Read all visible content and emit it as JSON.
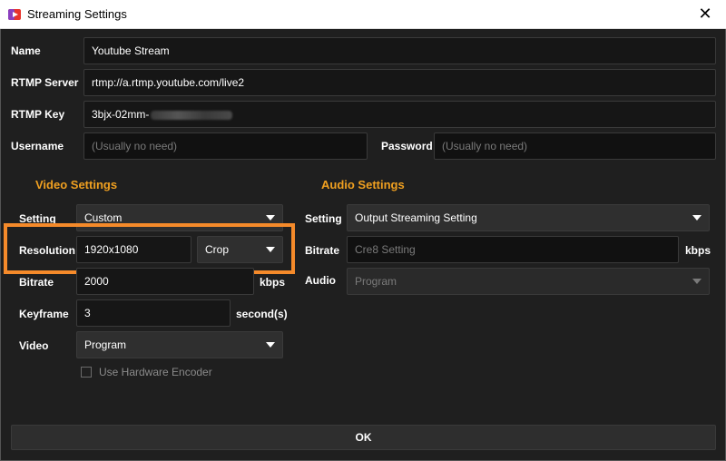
{
  "window": {
    "title": "Streaming Settings",
    "close_glyph": "✕",
    "app_icon": "app-logo-icon"
  },
  "stream": {
    "name_label": "Name",
    "name_value": "Youtube Stream",
    "server_label": "RTMP Server",
    "server_value": "rtmp://a.rtmp.youtube.com/live2",
    "key_label": "RTMP Key",
    "key_value": "3bjx-02mm-",
    "username_label": "Username",
    "username_placeholder": "(Usually no need)",
    "password_label": "Password",
    "password_placeholder": "(Usually no need)"
  },
  "video": {
    "section_title": "Video Settings",
    "setting_label": "Setting",
    "setting_value": "Custom",
    "resolution_label": "Resolution",
    "resolution_value": "1920x1080",
    "resolution_mode": "Crop",
    "bitrate_label": "Bitrate",
    "bitrate_value": "2000",
    "bitrate_unit": "kbps",
    "keyframe_label": "Keyframe",
    "keyframe_value": "3",
    "keyframe_unit": "second(s)",
    "video_label": "Video",
    "video_value": "Program",
    "hw_encoder_label": "Use Hardware Encoder",
    "hw_encoder_checked": false
  },
  "audio": {
    "section_title": "Audio Settings",
    "setting_label": "Setting",
    "setting_value": "Output Streaming Setting",
    "bitrate_label": "Bitrate",
    "bitrate_value": "Cre8 Setting",
    "bitrate_unit": "kbps",
    "audio_label": "Audio",
    "audio_value": "Program"
  },
  "footer": {
    "ok_label": "OK"
  },
  "colors": {
    "accent_section": "#f0a020",
    "highlight_box": "#f58a2a",
    "background": "#1f1f1f"
  }
}
